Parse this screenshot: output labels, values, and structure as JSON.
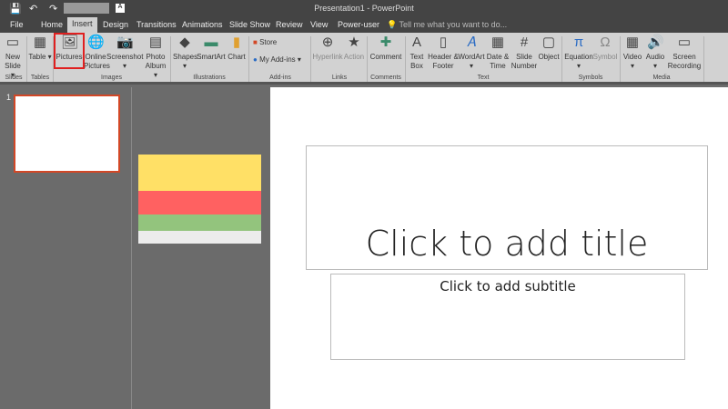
{
  "window": {
    "title": "Presentation1 - PowerPoint"
  },
  "quick_access": {
    "save": "💾",
    "undo": "↶",
    "redo": "↷",
    "font_box": "A"
  },
  "tabs": [
    "File",
    "Home",
    "Insert",
    "Design",
    "Transitions",
    "Animations",
    "Slide Show",
    "Review",
    "View",
    "Power-user"
  ],
  "tell_me": "Tell me what you want to do...",
  "ribbon": {
    "buttons": [
      {
        "label": "New Slide ▾",
        "icon": "▭"
      },
      {
        "label": "Table ▾",
        "icon": "▦"
      },
      {
        "label": "Pictures",
        "icon": "🖼"
      },
      {
        "label": "Online Pictures",
        "icon": "🌐"
      },
      {
        "label": "Screenshot ▾",
        "icon": "📷"
      },
      {
        "label": "Photo Album ▾",
        "icon": "▤"
      },
      {
        "label": "Shapes ▾",
        "icon": "◆"
      },
      {
        "label": "SmartArt",
        "icon": "▬"
      },
      {
        "label": "Chart",
        "icon": "▮"
      },
      {
        "label": "Hyperlink",
        "icon": "⊕"
      },
      {
        "label": "Action",
        "icon": "★"
      },
      {
        "label": "Comment",
        "icon": "✚"
      },
      {
        "label": "Text Box",
        "icon": "A"
      },
      {
        "label": "Header & Footer",
        "icon": "▯"
      },
      {
        "label": "WordArt ▾",
        "icon": "𝐴"
      },
      {
        "label": "Date & Time",
        "icon": "▦"
      },
      {
        "label": "Slide Number",
        "icon": "#"
      },
      {
        "label": "Object",
        "icon": "▢"
      },
      {
        "label": "Equation ▾",
        "icon": "π"
      },
      {
        "label": "Symbol",
        "icon": "Ω"
      },
      {
        "label": "Video ▾",
        "icon": "▦"
      },
      {
        "label": "Audio ▾",
        "icon": "🔊"
      },
      {
        "label": "Screen Recording",
        "icon": "▭"
      }
    ],
    "store": "Store",
    "my_addins": "My Add-ins ▾",
    "groups": [
      "Slides",
      "Tables",
      "Images",
      "Illustrations",
      "Add-ins",
      "Links",
      "Comments",
      "Text",
      "Symbols",
      "Media"
    ]
  },
  "thumbnails": {
    "number": "1"
  },
  "slide": {
    "title_placeholder": "Click to add title",
    "subtitle_placeholder": "Click to add subtitle"
  },
  "colors": {
    "yellow": "#ffe066",
    "red": "#ff6161",
    "green": "#93c47d",
    "light": "#ececec",
    "highlight": "#e02020"
  }
}
